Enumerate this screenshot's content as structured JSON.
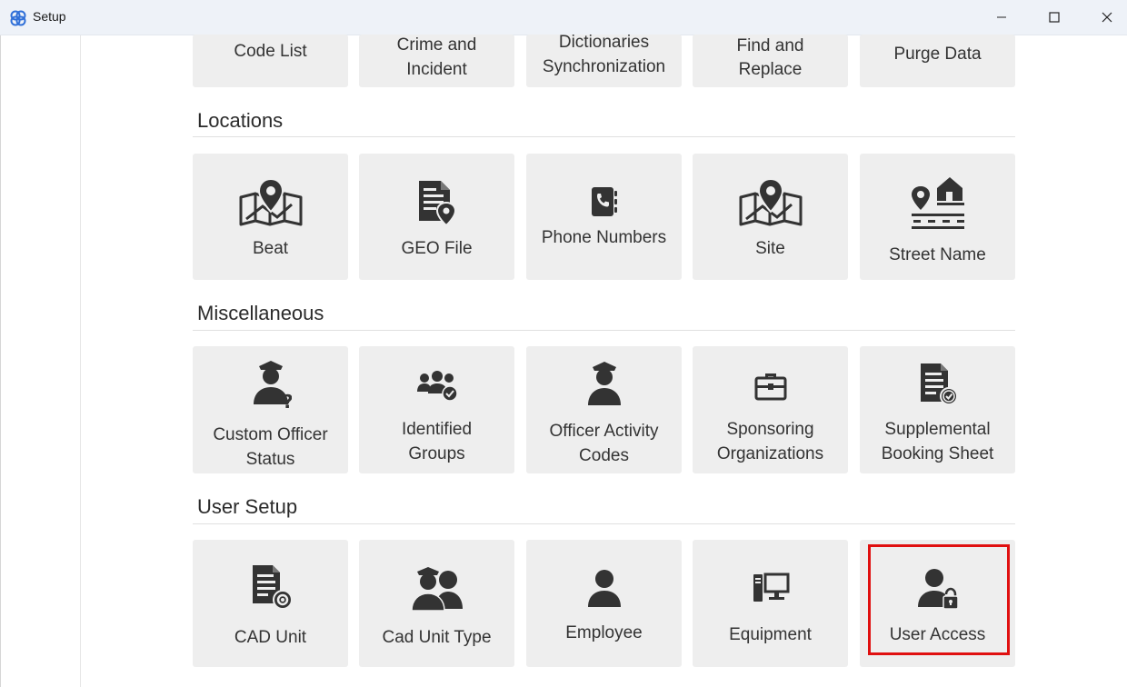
{
  "window": {
    "title": "Setup",
    "icons": {
      "app": "app-logo-icon",
      "minimize": "minimize-icon",
      "maximize": "maximize-icon",
      "close": "close-icon"
    }
  },
  "sections": {
    "top": {
      "tiles": [
        {
          "line1": "Code List",
          "line2": ""
        },
        {
          "line1": "Crime and",
          "line2": "Incident"
        },
        {
          "line1": "Dictionaries",
          "line2": "Synchronization"
        },
        {
          "line1": "Find and",
          "line2": "Replace"
        },
        {
          "line1": "Purge Data",
          "line2": ""
        }
      ]
    },
    "locations": {
      "title": "Locations",
      "tiles": [
        {
          "label": "Beat",
          "icon": "map-pin-icon"
        },
        {
          "label": "GEO File",
          "icon": "geo-file-icon"
        },
        {
          "label": "Phone Numbers",
          "icon": "phone-book-icon"
        },
        {
          "label": "Site",
          "icon": "map-pin-icon"
        },
        {
          "label": "Street Name",
          "icon": "street-house-icon"
        }
      ]
    },
    "misc": {
      "title": "Miscellaneous",
      "tiles": [
        {
          "line1": "Custom Officer",
          "line2": "Status",
          "icon": "officer-question-icon"
        },
        {
          "line1": "Identified",
          "line2": "Groups",
          "icon": "group-check-icon"
        },
        {
          "line1": "Officer Activity",
          "line2": "Codes",
          "icon": "officer-icon"
        },
        {
          "line1": "Sponsoring",
          "line2": "Organizations",
          "icon": "briefcase-icon"
        },
        {
          "line1": "Supplemental",
          "line2": "Booking Sheet",
          "icon": "document-check-icon"
        }
      ]
    },
    "user_setup": {
      "title": "User Setup",
      "tiles": [
        {
          "label": "CAD Unit",
          "icon": "document-gear-icon"
        },
        {
          "label": "Cad Unit Type",
          "icon": "officer-pair-icon"
        },
        {
          "label": "Employee",
          "icon": "user-icon"
        },
        {
          "label": "Equipment",
          "icon": "workstation-icon"
        },
        {
          "label": "User Access",
          "icon": "user-lock-icon"
        }
      ]
    }
  },
  "colors": {
    "tile_bg": "#eeeeee",
    "icon": "#333333",
    "highlight": "#e01010",
    "titlebar": "#eef2f8"
  }
}
